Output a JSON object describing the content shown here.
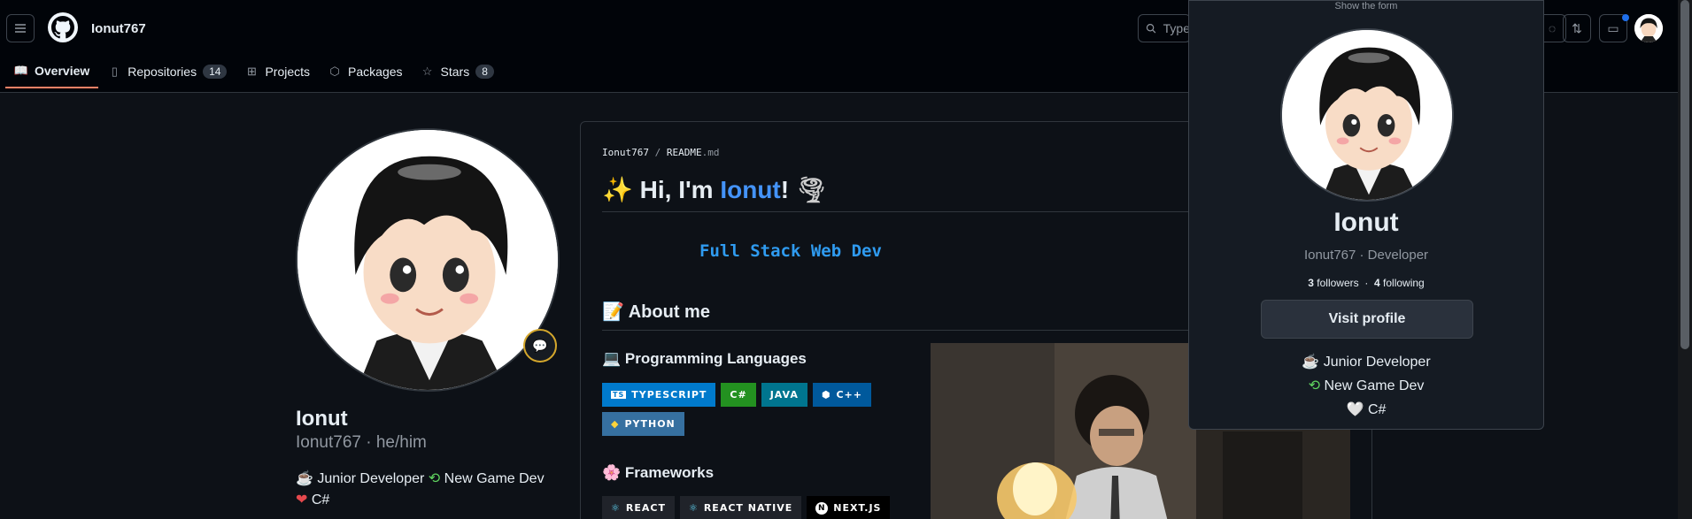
{
  "header": {
    "username": "Ionut767",
    "search_placeholder": "Type",
    "tabs": [
      {
        "label": "Overview",
        "icon": "book-icon",
        "count": ""
      },
      {
        "label": "Repositories",
        "icon": "repo-icon",
        "count": "14"
      },
      {
        "label": "Projects",
        "icon": "table-icon",
        "count": ""
      },
      {
        "label": "Packages",
        "icon": "package-icon",
        "count": ""
      },
      {
        "label": "Stars",
        "icon": "star-icon",
        "count": "8"
      }
    ]
  },
  "profile": {
    "name": "Ionut",
    "username_line": "Ionut767 · he/him",
    "bio_line1_a": "Junior Developer",
    "bio_line1_b": "New Game Dev",
    "bio_line2": "C#"
  },
  "readme": {
    "crumb_user": "Ionut767",
    "crumb_sep": "/",
    "crumb_file": "README",
    "crumb_ext": ".md",
    "greeting_pre": "Hi, I'm ",
    "greeting_name": "Ionut",
    "greeting_post": "!",
    "tagline": "Full Stack Web Dev",
    "about_heading": "About me",
    "lang_heading": "Programming Languages",
    "languages": [
      "TYPESCRIPT",
      "C#",
      "JAVA",
      "C++",
      "PYTHON"
    ],
    "frameworks_heading": "Frameworks",
    "frameworks": [
      "REACT",
      "REACT NATIVE",
      "NEXT.JS"
    ]
  },
  "hovercard": {
    "hint": "Show the form",
    "name": "Ionut",
    "subtitle": "Ionut767 · Developer",
    "followers_count": "3",
    "followers_label": "followers",
    "following_count": "4",
    "following_label": "following",
    "visit_label": "Visit profile",
    "bio1": "Junior Developer",
    "bio2": "New Game Dev",
    "bio3": "C#"
  },
  "colors": {
    "accent": "#f78166",
    "link": "#4493f8",
    "typescript": "#007acc",
    "csharp": "#239120",
    "java": "#00758f",
    "cpp": "#00599c",
    "python": "#3670a0"
  }
}
